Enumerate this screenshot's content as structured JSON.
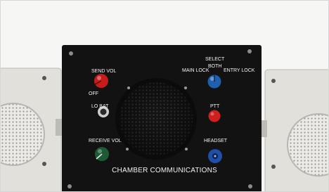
{
  "photo": {
    "panel_color": "#121212",
    "speaker_housing_color": "#e2e0db",
    "send_knob_color": "#c61c1c",
    "select_knob_color": "#1f5fae",
    "ptt_button_color": "#d01f1f",
    "receive_knob_color": "#1d5b34",
    "headset_jack_color": "#1f4fa8"
  },
  "labels": {
    "send_vol": "SEND VOL",
    "off": "OFF",
    "lo_bat": "LO BAT",
    "receive_vol": "RECEIVE VOL",
    "select": "SELECT",
    "both": "BOTH",
    "main_lock": "MAIN LOCK",
    "entry_lock": "ENTRY LOCK",
    "ptt": "PTT",
    "headset": "HEADSET",
    "caption": "CHAMBER COMMUNICATIONS"
  }
}
